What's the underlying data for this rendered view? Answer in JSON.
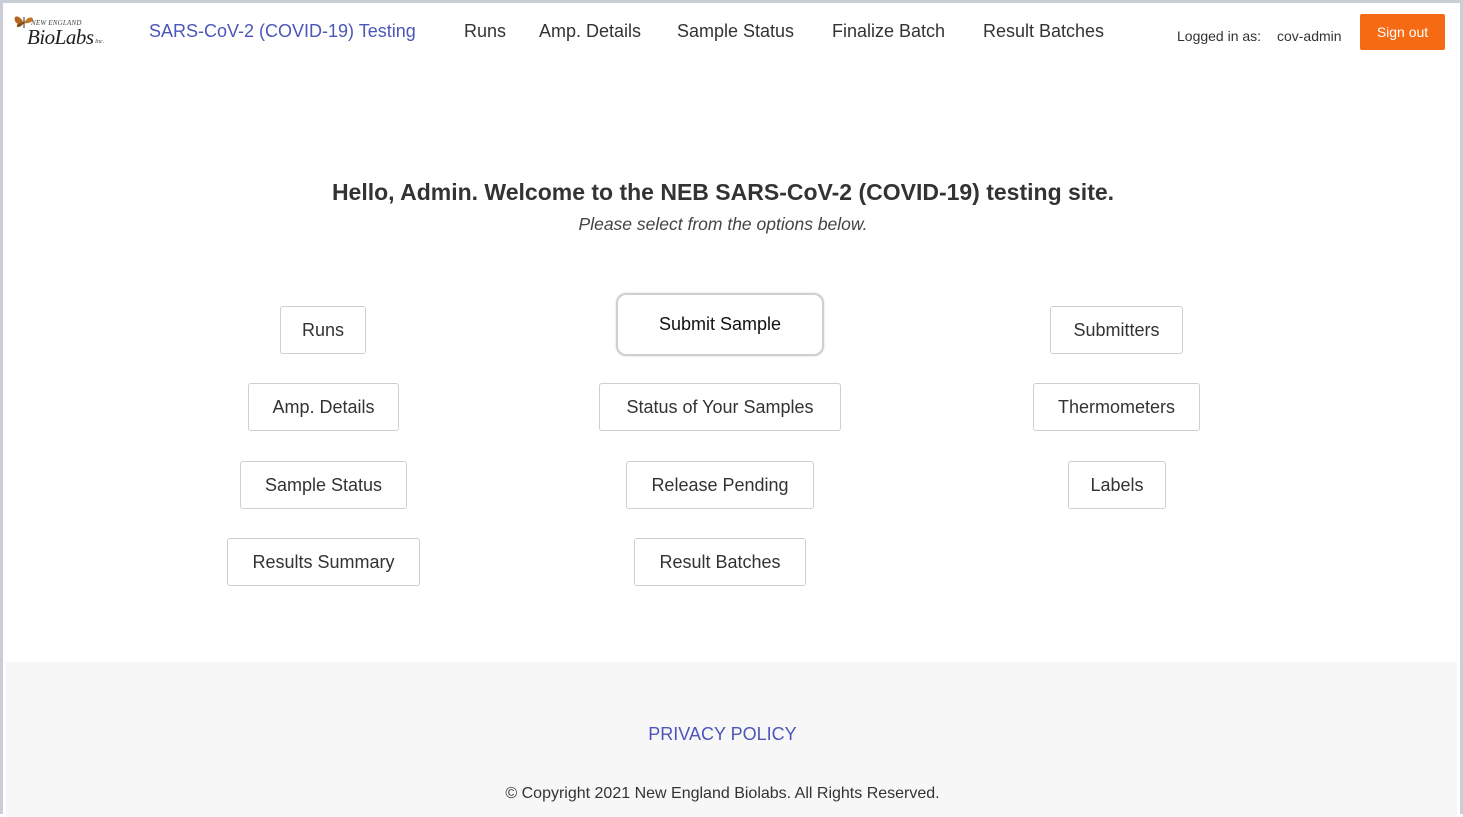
{
  "header": {
    "logo": {
      "small_text": "NEW ENGLAND",
      "main_text": "BioLabs",
      "suffix": "Inc."
    },
    "brand_link": "SARS-CoV-2 (COVID-19) Testing",
    "nav": {
      "runs": "Runs",
      "amp_details": "Amp. Details",
      "sample_status": "Sample Status",
      "finalize_batch": "Finalize Batch",
      "result_batches": "Result Batches"
    },
    "logged_in_label": "Logged in as:",
    "username": "cov-admin",
    "sign_out": "Sign out"
  },
  "main": {
    "welcome": "Hello, Admin. Welcome to the NEB SARS-CoV-2 (COVID-19) testing site.",
    "subtitle": "Please select from the options below.",
    "left_column": {
      "runs": "Runs",
      "amp_details": "Amp. Details",
      "sample_status": "Sample Status",
      "results_summary": "Results Summary"
    },
    "center_column": {
      "submit_sample": "Submit Sample",
      "status_of_samples": "Status of Your Samples",
      "release_pending": "Release Pending",
      "result_batches": "Result Batches"
    },
    "right_column": {
      "submitters": "Submitters",
      "thermometers": "Thermometers",
      "labels": "Labels"
    }
  },
  "footer": {
    "privacy_policy": "PRIVACY POLICY",
    "copyright": "© Copyright 2021 New England Biolabs. All Rights Reserved."
  },
  "colors": {
    "accent_link": "#4c56b8",
    "sign_out_button": "#f56a12",
    "footer_background": "#f7f7f7"
  }
}
